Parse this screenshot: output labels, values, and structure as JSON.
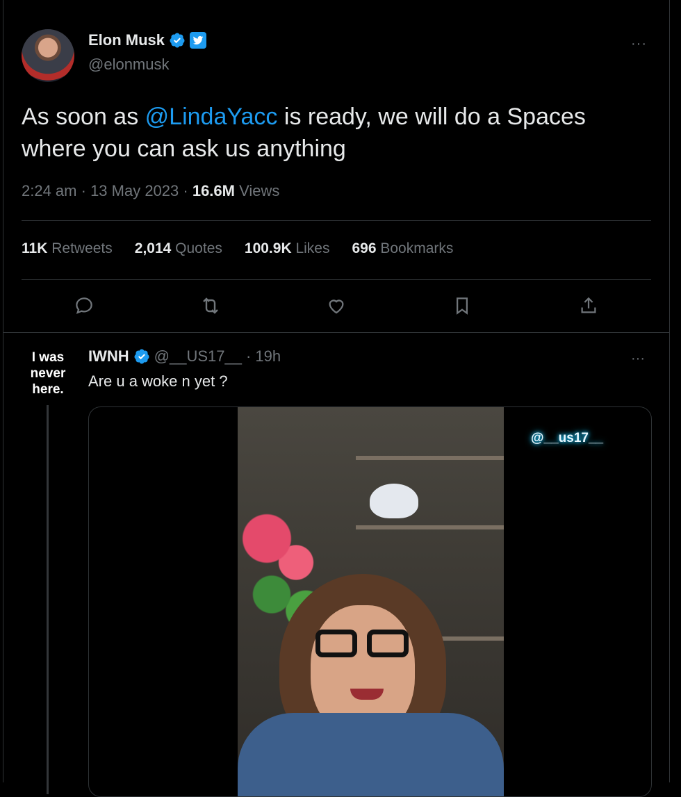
{
  "tweet": {
    "author_name": "Elon Musk",
    "author_handle": "@elonmusk",
    "text_before": "As soon as ",
    "mention": "@LindaYacc",
    "text_after": " is ready, we will do a Spaces where you can ask us anything",
    "time": "2:24 am",
    "date": "13 May 2023",
    "views_count": "16.6M",
    "views_label": "Views",
    "more_label": "···"
  },
  "stats": {
    "retweets_count": "11K",
    "retweets_label": "Retweets",
    "quotes_count": "2,014",
    "quotes_label": "Quotes",
    "likes_count": "100.9K",
    "likes_label": "Likes",
    "bookmarks_count": "696",
    "bookmarks_label": "Bookmarks"
  },
  "actions": [
    "reply-icon",
    "retweet-icon",
    "like-icon",
    "bookmark-icon",
    "share-icon"
  ],
  "reply": {
    "avatar_text_1": "I was",
    "avatar_text_2": "never",
    "avatar_text_3": "here.",
    "name": "IWNH",
    "handle": "@__US17__",
    "time": "· 19h",
    "text": "Are u a woke n yet ?",
    "more_label": "···",
    "video_watermark": "@__us17__"
  },
  "colors": {
    "accent": "#1d9bf0",
    "background": "#000000",
    "text_primary": "#e7e9ea",
    "text_secondary": "#71767b"
  }
}
